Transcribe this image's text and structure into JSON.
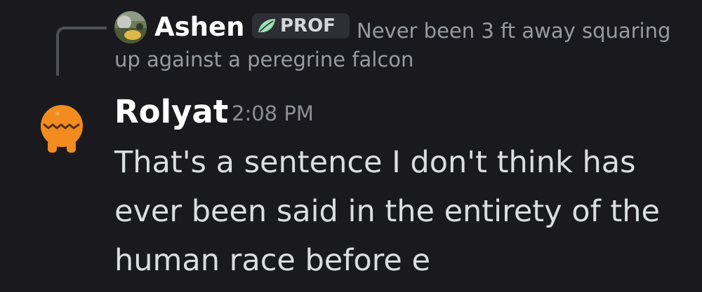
{
  "reply": {
    "author": "Ashen",
    "role_badge": "PROF",
    "role_icon": "leaf-icon",
    "avatar_icon": "photo-avatar",
    "text_line1": "Never been 3 ft away squaring",
    "text_line2": "up against a peregrine falcon"
  },
  "message": {
    "author": "Rolyat",
    "timestamp": "2:08 PM",
    "avatar_icon": "orange-blob-avatar",
    "lines": [
      "That's a sentence I don't think has",
      "ever been said in the entirety of the",
      "human race before e"
    ]
  },
  "colors": {
    "background": "#1a1a1e",
    "username": "#ffffff",
    "reply_text": "#979aa1",
    "message_text": "#dbdee1",
    "timestamp": "#8d8f97",
    "role_accent": "#9be2b5",
    "avatar_orange": "#f28c1e"
  }
}
